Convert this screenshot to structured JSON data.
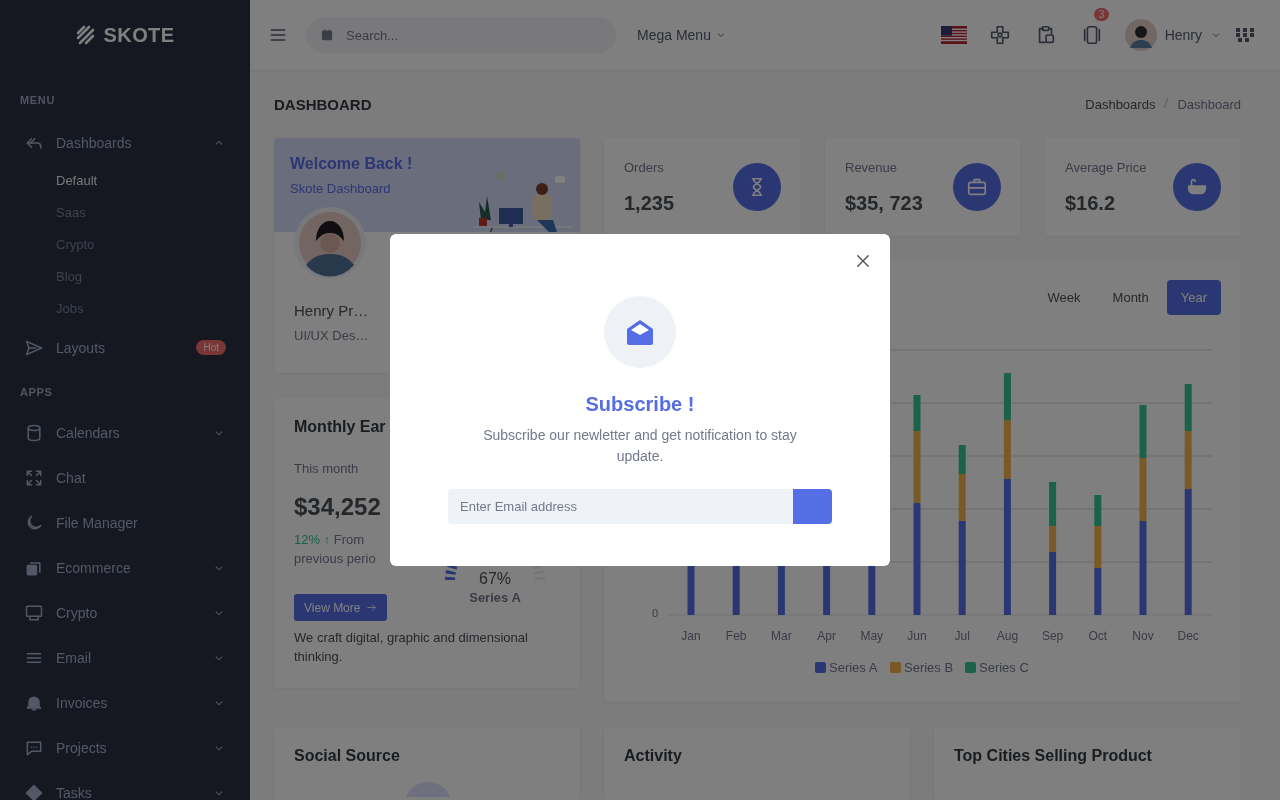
{
  "sidebar": {
    "logo": "SKOTE",
    "sections": [
      {
        "title": "MENU",
        "items": [
          {
            "label": "Dashboards",
            "kind": "group",
            "expanded": true,
            "children": [
              {
                "label": "Default",
                "selected": true
              },
              {
                "label": "Saas",
                "selected": false
              },
              {
                "label": "Crypto",
                "selected": false
              },
              {
                "label": "Blog",
                "selected": false
              },
              {
                "label": "Jobs",
                "selected": false
              }
            ]
          },
          {
            "label": "Layouts",
            "kind": "link",
            "badge": "Hot"
          }
        ]
      },
      {
        "title": "APPS",
        "items": [
          {
            "label": "Calendars",
            "kind": "group",
            "expanded": false
          },
          {
            "label": "Chat",
            "kind": "link"
          },
          {
            "label": "File Manager",
            "kind": "link"
          },
          {
            "label": "Ecommerce",
            "kind": "group",
            "expanded": false
          },
          {
            "label": "Crypto",
            "kind": "group",
            "expanded": false
          },
          {
            "label": "Email",
            "kind": "group",
            "expanded": false
          },
          {
            "label": "Invoices",
            "kind": "group",
            "expanded": false
          },
          {
            "label": "Projects",
            "kind": "group",
            "expanded": false
          },
          {
            "label": "Tasks",
            "kind": "group",
            "expanded": false
          }
        ]
      }
    ]
  },
  "topbar": {
    "search": {
      "placeholder": "Search..."
    },
    "mega_menu": "Mega Menu",
    "notification_count": "3",
    "user": "Henry"
  },
  "page": {
    "title": "DASHBOARD",
    "breadcrumb": [
      {
        "label": "Dashboards",
        "selected": false
      },
      {
        "label": "Dashboard",
        "selected": true
      }
    ]
  },
  "welcome": {
    "title": "Welcome Back !",
    "subtitle": "Skote Dashboard",
    "name": "Henry Pr…",
    "role": "UI/UX Des…"
  },
  "stats": [
    {
      "label": "Orders",
      "value": "1,235"
    },
    {
      "label": "Revenue",
      "value": "$35, 723"
    },
    {
      "label": "Average Price",
      "value": "$16.2"
    }
  ],
  "earning": {
    "title": "Monthly Ear",
    "period": "This month",
    "amount": "$34,252",
    "change": "12% ↑",
    "note": "From previous perio",
    "button": "View More",
    "radial_value": "67%",
    "radial_label": "Series A",
    "text": "We craft digital, graphic and dimensional thinking."
  },
  "chart": {
    "tabs": [
      {
        "label": "Week",
        "selected": false
      },
      {
        "label": "Month",
        "selected": false
      },
      {
        "label": "Year",
        "selected": true
      }
    ],
    "zero_tick": "0",
    "months": [
      "Jan",
      "Feb",
      "Mar",
      "Apr",
      "May",
      "Jun",
      "Jul",
      "Aug",
      "Sep",
      "Oct",
      "Nov",
      "Dec"
    ],
    "legend": [
      {
        "name": "Series A",
        "color": "#2b3773"
      },
      {
        "name": "Series B",
        "color": "#795a26"
      },
      {
        "name": "Series C",
        "color": "#1a6248"
      }
    ]
  },
  "bottom_cards": [
    {
      "title": "Social Source"
    },
    {
      "title": "Activity"
    },
    {
      "title": "Top Cities Selling Product"
    }
  ],
  "modal": {
    "title": "Subscribe !",
    "text": "Subscribe our newletter and get notification to stay update.",
    "email_placeholder": "Enter Email address"
  }
}
